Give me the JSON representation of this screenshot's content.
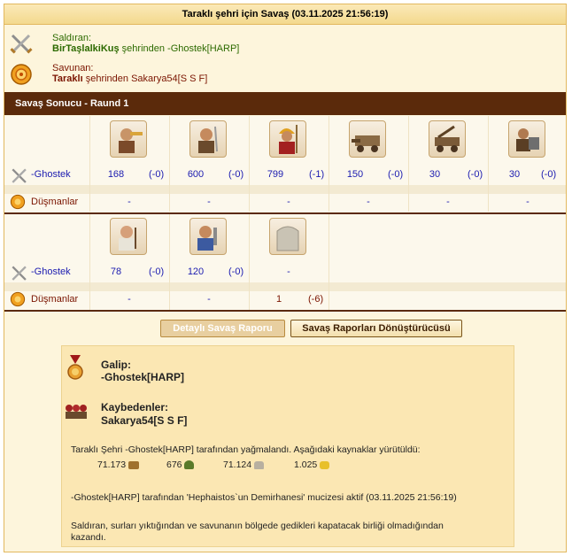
{
  "title": "Taraklı şehri için Savaş (03.11.2025 21:56:19)",
  "attacker": {
    "label": "Saldıran:",
    "city": "BirTaşlalkiKuş",
    "from_text": " şehrinden -Ghostek[HARP]"
  },
  "defender": {
    "label": "Savunan:",
    "city": "Taraklı",
    "from_text": " şehrinden Sakarya54[S S F]"
  },
  "result_bar": "Savaş Sonucu - Raund 1",
  "rows": {
    "attacker_name": "-Ghostek",
    "enemy_name": "Düşmanlar"
  },
  "units_row1": [
    {
      "icon": "trumpeter-unit-icon",
      "count": "168",
      "loss": "(-0)",
      "enemy": "-"
    },
    {
      "icon": "warrior-unit-icon",
      "count": "600",
      "loss": "(-0)",
      "enemy": "-"
    },
    {
      "icon": "hoplite-unit-icon",
      "count": "799",
      "loss": "(-1)",
      "enemy": "-"
    },
    {
      "icon": "ram-unit-icon",
      "count": "150",
      "loss": "(-0)",
      "enemy": "-"
    },
    {
      "icon": "catapult-unit-icon",
      "count": "30",
      "loss": "(-0)",
      "enemy": "-"
    },
    {
      "icon": "mortar-unit-icon",
      "count": "30",
      "loss": "(-0)",
      "enemy": "-"
    }
  ],
  "units_row2": [
    {
      "icon": "doctor-unit-icon",
      "count": "78",
      "loss": "(-0)",
      "enemy": "-",
      "enemy_loss": ""
    },
    {
      "icon": "cook-unit-icon",
      "count": "120",
      "loss": "(-0)",
      "enemy": "-",
      "enemy_loss": ""
    },
    {
      "icon": "wall-unit-icon",
      "count": "-",
      "loss": "",
      "enemy": "1",
      "enemy_loss": "(-6)"
    }
  ],
  "buttons": {
    "detailed": "Detaylı Savaş Raporu",
    "converter": "Savaş Raporları Dönüştürücüsü"
  },
  "winner": {
    "label": "Galip:",
    "name": "-Ghostek[HARP]"
  },
  "losers": {
    "label": "Kaybedenler:",
    "name": "Sakarya54[S S F]"
  },
  "plunder_text": "Taraklı Şehri -Ghostek[HARP] tarafından yağmalandı. Aşağıdaki kaynaklar yürütüldü:",
  "resources": [
    {
      "value": "71.173",
      "icon": "wood-icon"
    },
    {
      "value": "676",
      "icon": "wine-icon"
    },
    {
      "value": "71.124",
      "icon": "marble-icon"
    },
    {
      "value": "1.025",
      "icon": "sulfur-icon"
    }
  ],
  "miracle_text": "-Ghostek[HARP] tarafından 'Hephaistos`un Demirhanesi' mucizesi aktif (03.11.2025 21:56:19)",
  "final_text_1": "Saldıran, surları yıktığından ve savunanın bölgede gedikleri kapatacak birliği olmadığından",
  "final_text_2": "kazandı."
}
